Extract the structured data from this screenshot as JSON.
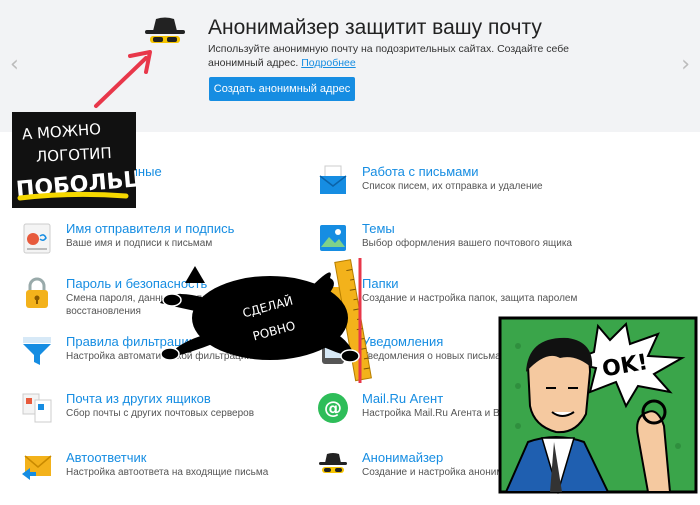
{
  "banner": {
    "title": "Анонимайзер защитит вашу почту",
    "text": "Используйте анонимную почту на подозрительных сайтах. Создайте себе анонимный адрес.",
    "link": "Подробнее",
    "button": "Создать анонимный адрес",
    "prev_icon": "chevron-left-icon",
    "next_icon": "chevron-right-icon"
  },
  "settings": [
    {
      "title": "Личные данные",
      "desc": "**",
      "icon": "personal-data-icon"
    },
    {
      "title": "Работа с письмами",
      "desc": "Список писем, их отправка и удаление",
      "icon": "mail-work-icon"
    },
    {
      "title": "Имя отправителя и подпись",
      "desc": "Ваше имя и подписи к письмам",
      "icon": "signature-icon"
    },
    {
      "title": "Темы",
      "desc": "Выбор оформления вашего почтового ящика",
      "icon": "themes-icon"
    },
    {
      "title": "Пароль и безопасность",
      "desc": "Смена пароля, данных безопасности и восстановления",
      "icon": "lock-icon"
    },
    {
      "title": "Папки",
      "desc": "Создание и настройка папок, защита паролем",
      "icon": "folders-icon"
    },
    {
      "title": "Правила фильтрации",
      "desc": "Настройка автоматической фильтрации",
      "icon": "filter-icon"
    },
    {
      "title": "Уведомления",
      "desc": "Уведомления о новых письмах",
      "icon": "notifications-icon"
    },
    {
      "title": "Почта из других ящиков",
      "desc": "Сбор почты с других почтовых серверов",
      "icon": "collector-icon"
    },
    {
      "title": "Mail.Ru Агент",
      "desc": "Настройка Mail.Ru Агента и Веб-Агента",
      "icon": "agent-icon"
    },
    {
      "title": "Автоответчик",
      "desc": "Настройка автоответа на входящие письма",
      "icon": "autoreply-icon"
    },
    {
      "title": "Анонимайзер",
      "desc": "Создание и настройка анонимных адресов",
      "icon": "anonymizer-icon"
    }
  ],
  "stickers": {
    "chalk": [
      "А МОЖНО",
      "ЛОГОТИП",
      "ПОБОЛЬШЕ?"
    ],
    "cat": [
      "СДЕЛАЙ",
      "РОВНО"
    ],
    "ok": "OK!"
  },
  "colors": {
    "accent": "#168de2",
    "banner_bg": "#f2f3f5",
    "arrow": "#e8374a",
    "ok_bg": "#3aa54a"
  }
}
